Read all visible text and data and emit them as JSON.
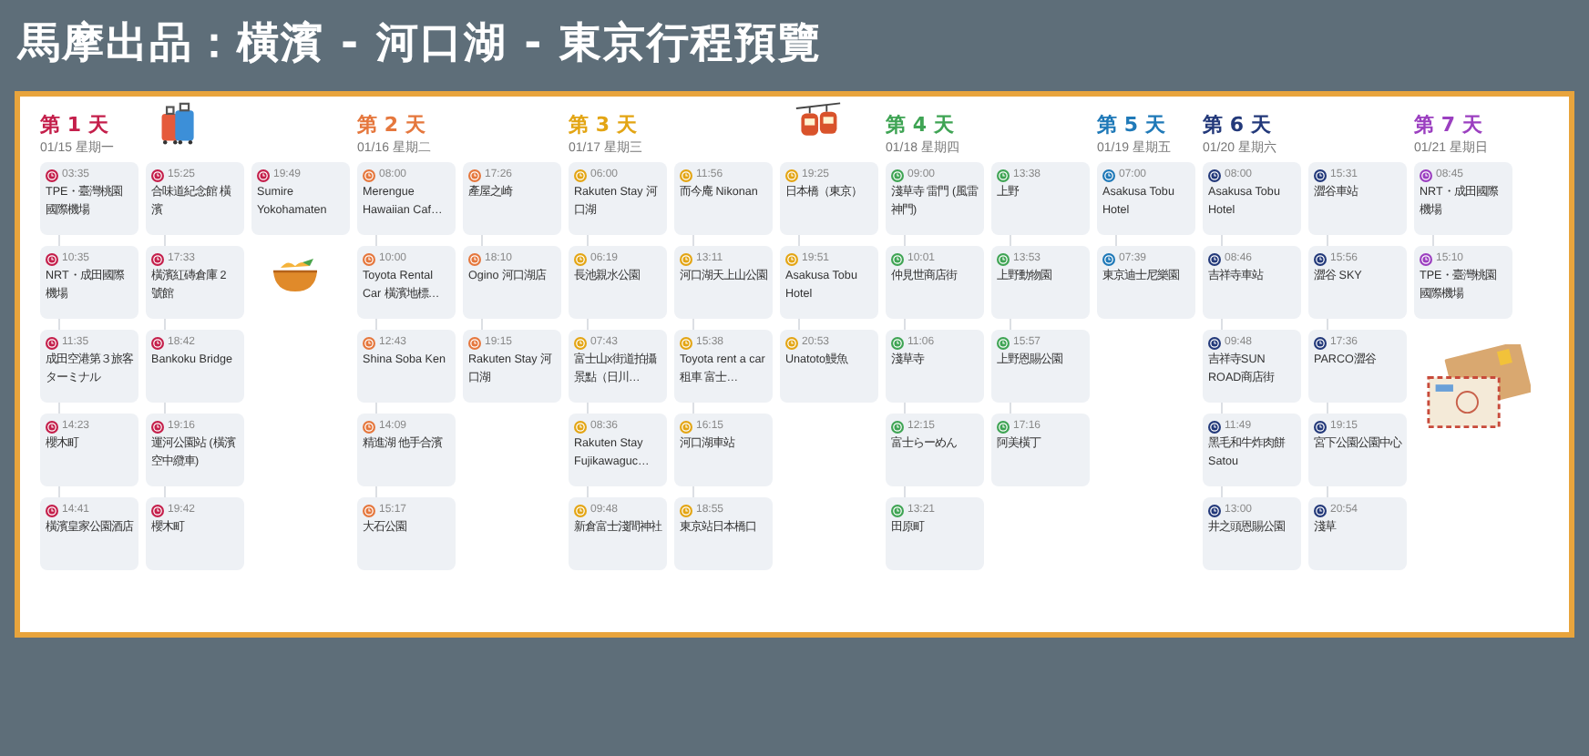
{
  "title": "馬摩出品：橫濱 - 河口湖 - 東京行程預覽",
  "days": [
    {
      "label": "第 1 天",
      "date": "01/15 星期一",
      "color": "#c41f4b",
      "columns": [
        [
          {
            "time": "03:35",
            "name": "TPE・臺灣桃園國際機場"
          },
          {
            "time": "10:35",
            "name": "NRT・成田國際機場"
          },
          {
            "time": "11:35",
            "name": "成田空港第３旅客ターミナル"
          },
          {
            "time": "14:23",
            "name": "櫻木町"
          },
          {
            "time": "14:41",
            "name": "橫濱皇家公園酒店"
          }
        ],
        [
          {
            "time": "15:25",
            "name": "合味道紀念館 橫濱"
          },
          {
            "time": "17:33",
            "name": "橫濱紅磚倉庫 2 號館"
          },
          {
            "time": "18:42",
            "name": "Bankoku Bridge"
          },
          {
            "time": "19:16",
            "name": "運河公園站 (橫濱空中纜車)"
          },
          {
            "time": "19:42",
            "name": "櫻木町"
          }
        ],
        [
          {
            "time": "19:49",
            "name": "Sumire Yokohamaten"
          }
        ]
      ]
    },
    {
      "label": "第 2 天",
      "date": "01/16 星期二",
      "color": "#e5773d",
      "columns": [
        [
          {
            "time": "08:00",
            "name": "Merengue Hawaiian Caf…"
          },
          {
            "time": "10:00",
            "name": "Toyota Rental Car 橫濱地標…"
          },
          {
            "time": "12:43",
            "name": "Shina Soba Ken"
          },
          {
            "time": "14:09",
            "name": "精進湖 他手合濱"
          },
          {
            "time": "15:17",
            "name": "大石公園"
          }
        ],
        [
          {
            "time": "17:26",
            "name": "產屋之崎"
          },
          {
            "time": "18:10",
            "name": "Ogino 河口湖店"
          },
          {
            "time": "19:15",
            "name": "Rakuten Stay 河口湖"
          }
        ]
      ]
    },
    {
      "label": "第 3 天",
      "date": "01/17 星期三",
      "color": "#e3a514",
      "columns": [
        [
          {
            "time": "06:00",
            "name": "Rakuten Stay 河口湖"
          },
          {
            "time": "06:19",
            "name": "長池親水公園"
          },
          {
            "time": "07:43",
            "name": "富士山x街道拍攝景點（日川…"
          },
          {
            "time": "08:36",
            "name": "Rakuten Stay Fujikawaguc…"
          },
          {
            "time": "09:48",
            "name": "新倉富士淺間神社"
          }
        ],
        [
          {
            "time": "11:56",
            "name": "而今庵 Nikonan"
          },
          {
            "time": "13:11",
            "name": "河口湖天上山公園"
          },
          {
            "time": "15:38",
            "name": "Toyota rent a car 租車 富士…"
          },
          {
            "time": "16:15",
            "name": "河口湖車站"
          },
          {
            "time": "18:55",
            "name": "東京站日本橋口"
          }
        ],
        [
          {
            "time": "19:25",
            "name": "日本橋（東京）"
          },
          {
            "time": "19:51",
            "name": "Asakusa Tobu Hotel"
          },
          {
            "time": "20:53",
            "name": "Unatoto鰻魚"
          }
        ]
      ]
    },
    {
      "label": "第 4 天",
      "date": "01/18 星期四",
      "color": "#3fa454",
      "columns": [
        [
          {
            "time": "09:00",
            "name": "淺草寺 雷門 (風雷神門)"
          },
          {
            "time": "10:01",
            "name": "仲見世商店街"
          },
          {
            "time": "11:06",
            "name": "淺草寺"
          },
          {
            "time": "12:15",
            "name": "富士らーめん"
          },
          {
            "time": "13:21",
            "name": "田原町"
          }
        ],
        [
          {
            "time": "13:38",
            "name": "上野"
          },
          {
            "time": "13:53",
            "name": "上野動物園"
          },
          {
            "time": "15:57",
            "name": "上野恩賜公園"
          },
          {
            "time": "17:16",
            "name": "阿美橫丁"
          }
        ]
      ]
    },
    {
      "label": "第 5 天",
      "date": "01/19 星期五",
      "color": "#1f79b8",
      "columns": [
        [
          {
            "time": "07:00",
            "name": "Asakusa Tobu Hotel"
          },
          {
            "time": "07:39",
            "name": "東京迪士尼樂園"
          }
        ]
      ]
    },
    {
      "label": "第 6 天",
      "date": "01/20 星期六",
      "color": "#23397a",
      "columns": [
        [
          {
            "time": "08:00",
            "name": "Asakusa Tobu Hotel"
          },
          {
            "time": "08:46",
            "name": "吉祥寺車站"
          },
          {
            "time": "09:48",
            "name": "吉祥寺SUN ROAD商店街"
          },
          {
            "time": "11:49",
            "name": "黑毛和牛炸肉餅 Satou"
          },
          {
            "time": "13:00",
            "name": "井之頭恩賜公園"
          }
        ],
        [
          {
            "time": "15:31",
            "name": "澀谷車站"
          },
          {
            "time": "15:56",
            "name": "澀谷 SKY"
          },
          {
            "time": "17:36",
            "name": "PARCO澀谷"
          },
          {
            "time": "19:15",
            "name": "宮下公園公園中心"
          },
          {
            "time": "20:54",
            "name": "淺草"
          }
        ]
      ]
    },
    {
      "label": "第 7 天",
      "date": "01/21 星期日",
      "color": "#9b3fc0",
      "columns": [
        [
          {
            "time": "08:45",
            "name": "NRT・成田國際機場"
          },
          {
            "time": "15:10",
            "name": "TPE・臺灣桃園國際機場"
          }
        ]
      ]
    }
  ]
}
